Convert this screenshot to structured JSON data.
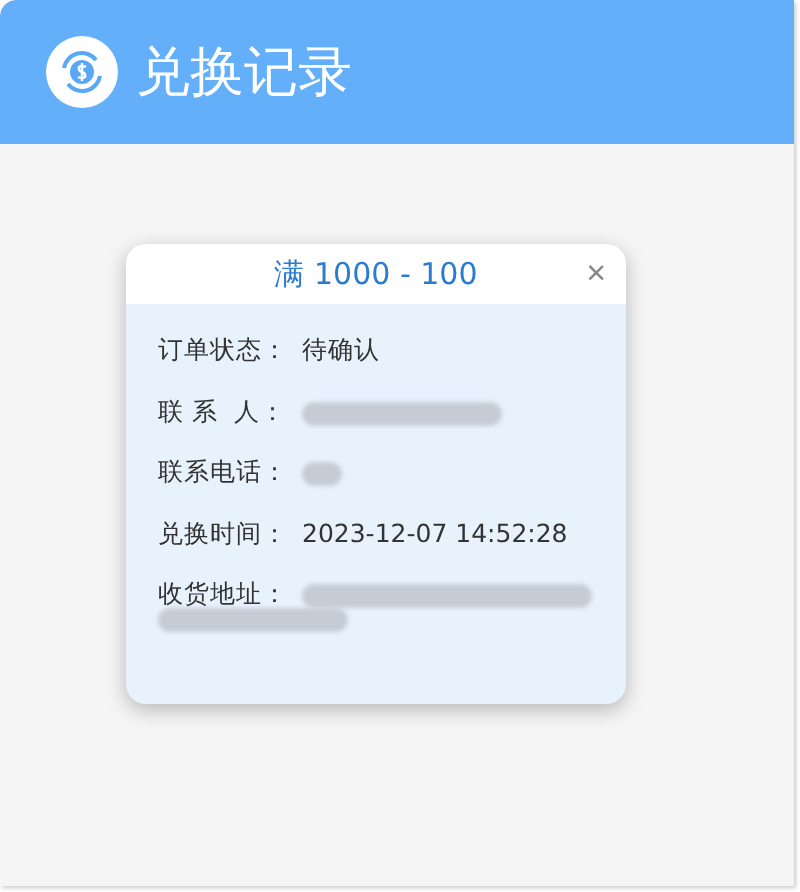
{
  "header": {
    "title": "兑换记录"
  },
  "card": {
    "title": "满 1000 - 100",
    "close": "×",
    "rows": [
      {
        "label": "订单状态：",
        "kind": "text",
        "value": "待确认"
      },
      {
        "label": "联 系  人：",
        "kind": "redacted"
      },
      {
        "label": "联系电话：",
        "kind": "redacted"
      },
      {
        "label": "兑换时间：",
        "kind": "text",
        "value": "2023-12-07 14:52:28"
      },
      {
        "label": "收货地址：",
        "kind": "redacted_wrap"
      }
    ]
  }
}
